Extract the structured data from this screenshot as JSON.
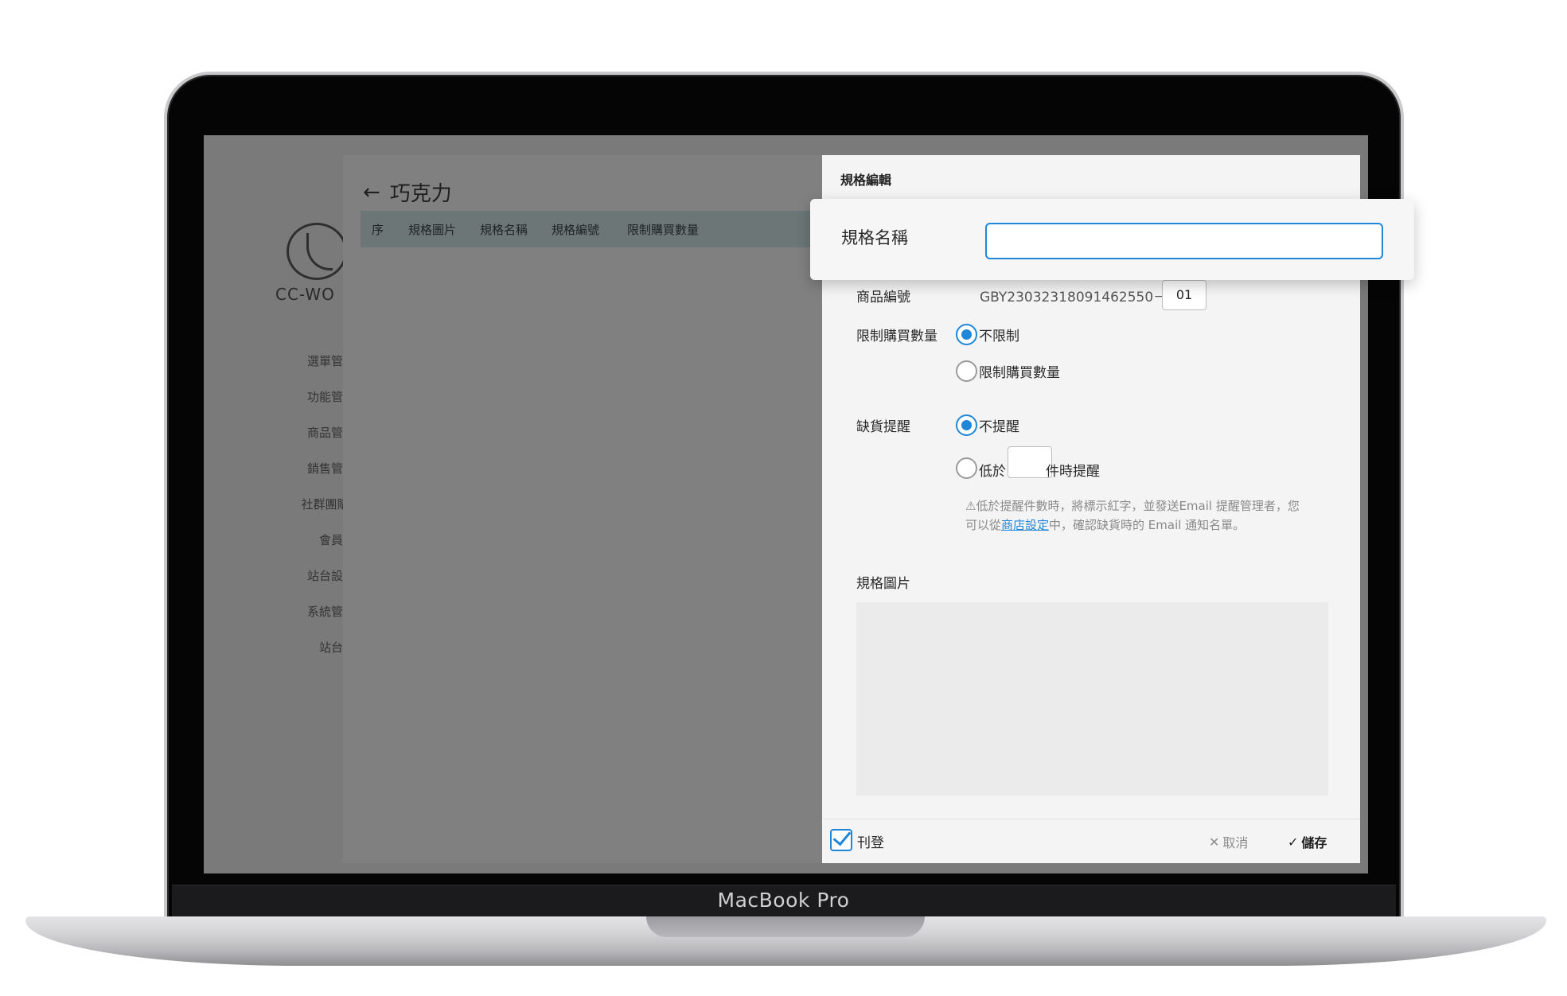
{
  "device": {
    "label": "MacBook Pro"
  },
  "sidebar": {
    "logo_text": "CC-WO",
    "items": [
      {
        "label": "選單管理"
      },
      {
        "label": "功能管理"
      },
      {
        "label": "商品管理"
      },
      {
        "label": "銷售管理"
      },
      {
        "label": "社群團購管"
      },
      {
        "label": "會員"
      },
      {
        "label": "站台設定"
      },
      {
        "label": "系統管理"
      },
      {
        "label": "站台"
      }
    ]
  },
  "list": {
    "title": "巧克力",
    "back_icon": "arrow-left-icon",
    "columns": [
      "序",
      "規格圖片",
      "規格名稱",
      "規格編號",
      "限制購買數量"
    ]
  },
  "dialog": {
    "title": "規格編輯",
    "spec_name": {
      "label": "規格名稱",
      "value": ""
    },
    "product_code": {
      "label": "商品編號",
      "prefix": "GBY23032318091462550－",
      "suffix": "01"
    },
    "purchase_limit": {
      "label": "限制購買數量",
      "options": [
        {
          "label": "不限制",
          "checked": true
        },
        {
          "label": "限制購買數量",
          "checked": false
        }
      ]
    },
    "stock_alert": {
      "label": "缺貨提醒",
      "options": [
        {
          "label": "不提醒",
          "checked": true
        },
        {
          "label_before": "低於",
          "label_after": "件時提醒",
          "checked": false
        }
      ],
      "note_before": "⚠低於提醒件數時，將標示紅字，並發送Email 提醒管理者，您可以從",
      "note_link": "商店設定",
      "note_after": "中，確認缺貨時的 Email 通知名單。"
    },
    "spec_image": {
      "label": "規格圖片"
    },
    "footer": {
      "publish_label": "刊登",
      "publish_checked": true,
      "cancel_label": "取消",
      "cancel_icon": "close-icon",
      "save_label": "儲存",
      "save_icon": "check-icon"
    }
  },
  "colors": {
    "accent": "#1f86d8",
    "overlay": "#7a7a7a",
    "panel_bg": "#f4f4f4"
  }
}
